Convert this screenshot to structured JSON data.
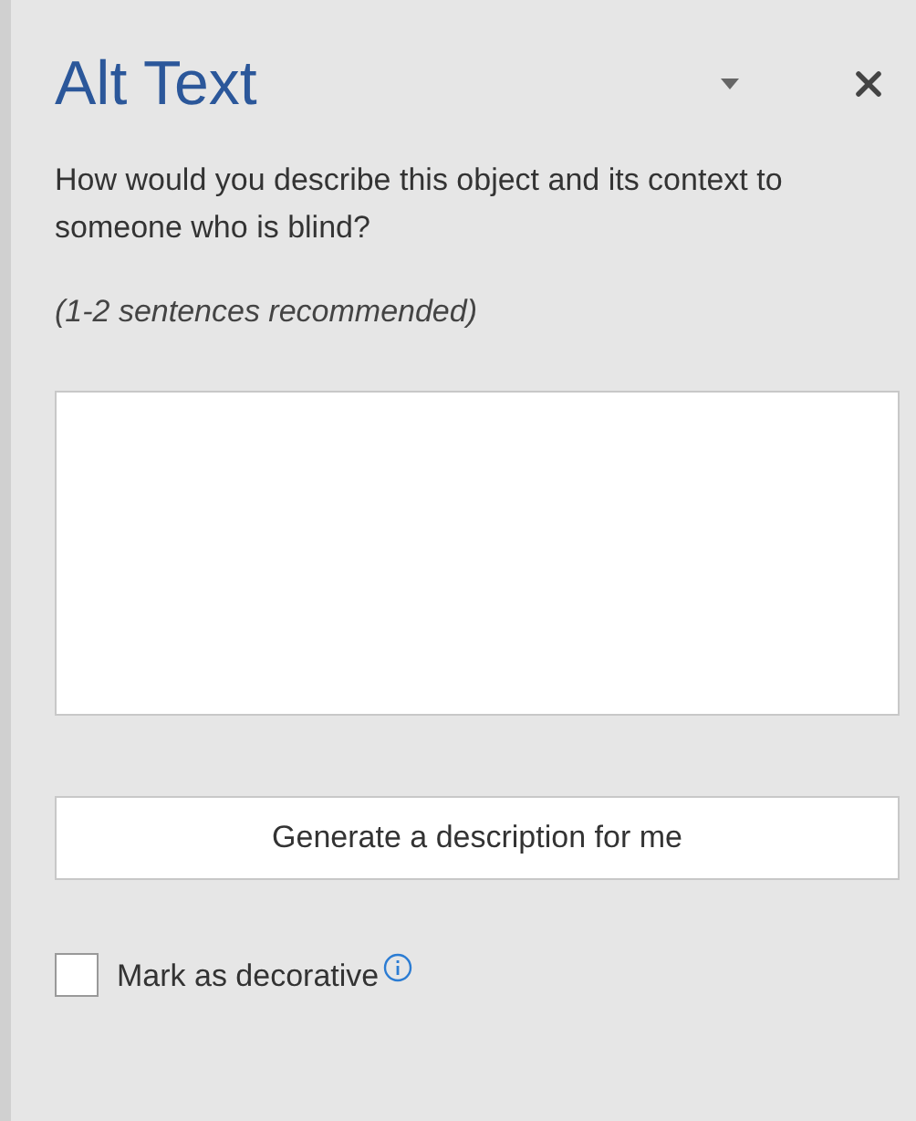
{
  "panel": {
    "title": "Alt Text"
  },
  "prompt": "How would you describe this object and its context to someone who is blind?",
  "hint": "(1-2 sentences recommended)",
  "generate_button": "Generate a description for me",
  "decorative": {
    "label": "Mark as decorative",
    "checked": false
  }
}
